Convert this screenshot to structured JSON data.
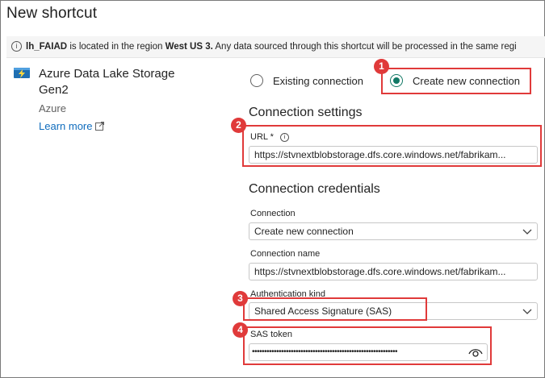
{
  "dialog": {
    "title": "New shortcut"
  },
  "info": {
    "lakehouse": "lh_FAIAD",
    "text_1": " is located in the region ",
    "region": "West US 3.",
    "text_2": " Any data sourced through this shortcut will be processed in the same regi"
  },
  "source": {
    "name": "Azure Data Lake Storage Gen2",
    "provider": "Azure",
    "learn_more": "Learn more",
    "icon": "storage-lightning-icon"
  },
  "connection_choice": {
    "existing_label": "Existing connection",
    "new_label": "Create new connection",
    "selected": "new"
  },
  "settings": {
    "heading": "Connection settings",
    "url_label": "URL *",
    "url_value": "https://stvnextblobstorage.dfs.core.windows.net/fabrikam..."
  },
  "credentials": {
    "heading": "Connection credentials",
    "connection_label": "Connection",
    "connection_value": "Create new connection",
    "connection_name_label": "Connection name",
    "connection_name_value": "https://stvnextblobstorage.dfs.core.windows.net/fabrikam...",
    "auth_label": "Authentication kind",
    "auth_value": "Shared Access Signature (SAS)",
    "sas_label": "SAS token",
    "sas_mask": "••••••••••••••••••••••••••••••••••••••••••••••••••••••••••••"
  },
  "callouts": [
    "1",
    "2",
    "3",
    "4"
  ],
  "colors": {
    "accent": "#117865",
    "callout": "#e03a3a",
    "link": "#0f6cbd"
  }
}
